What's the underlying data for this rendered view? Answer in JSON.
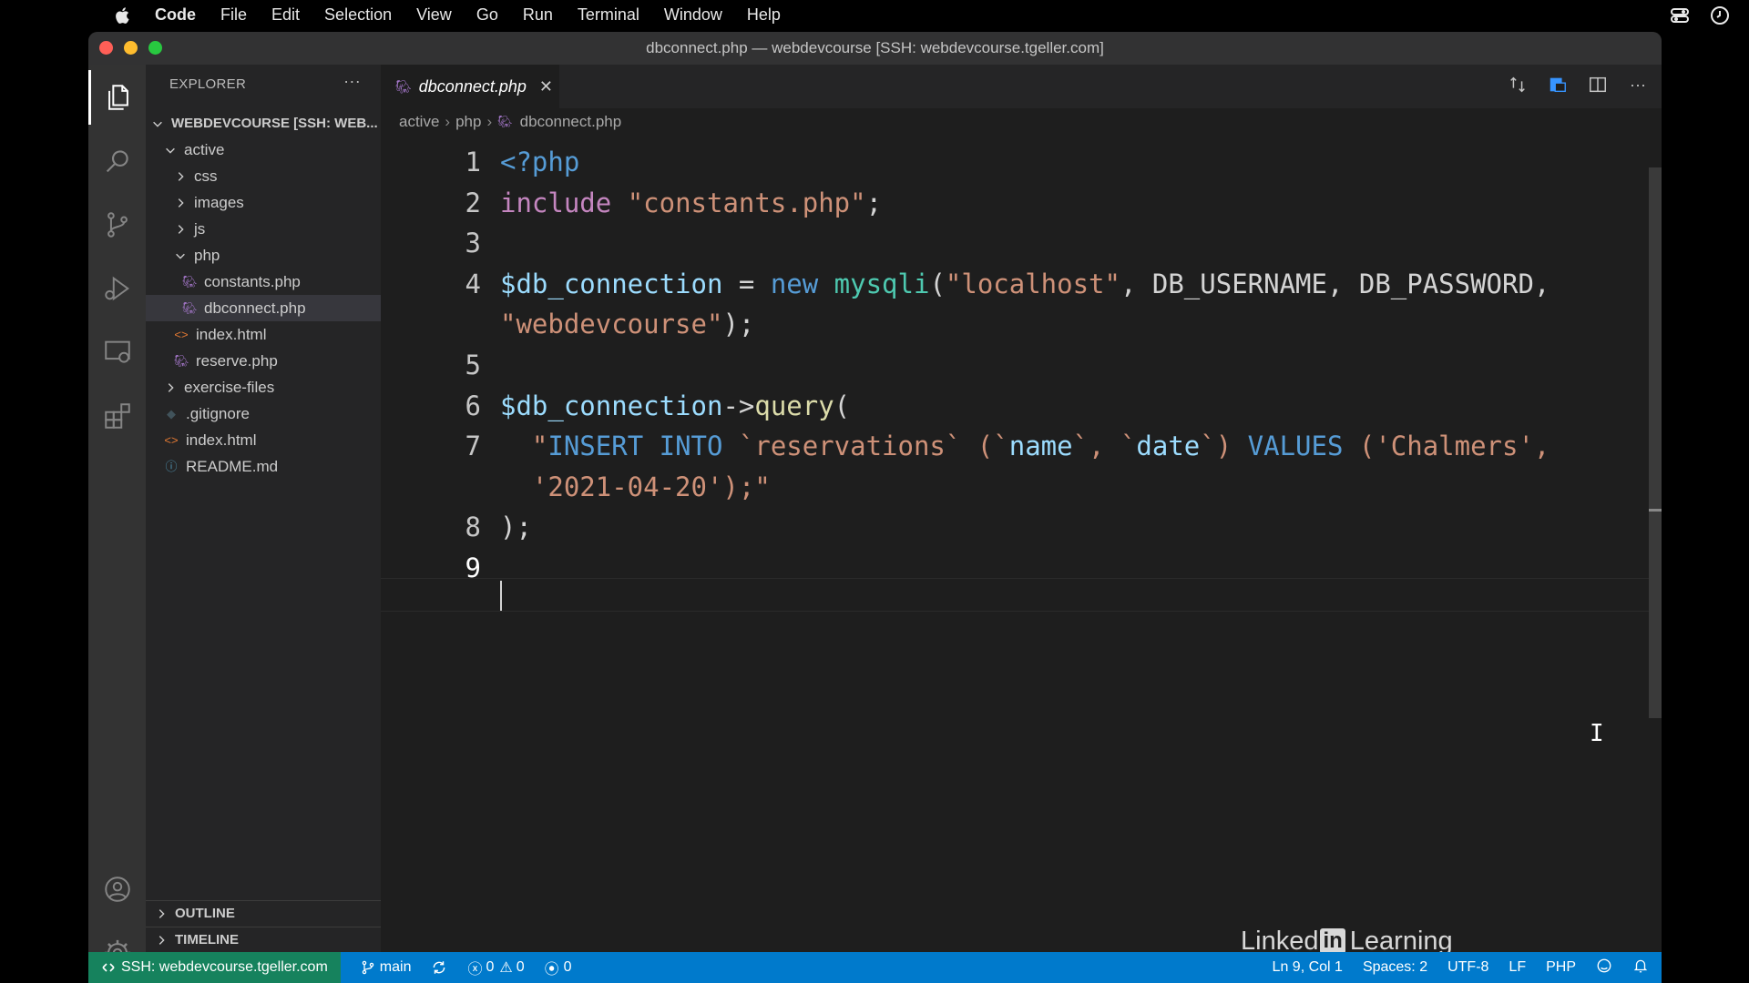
{
  "menubar": {
    "app": "Code",
    "items": [
      "File",
      "Edit",
      "Selection",
      "View",
      "Go",
      "Run",
      "Terminal",
      "Window",
      "Help"
    ]
  },
  "window": {
    "title": "dbconnect.php — webdevcourse [SSH: webdevcourse.tgeller.com]"
  },
  "sidebar": {
    "header": "EXPLORER",
    "root": "WEBDEVCOURSE [SSH: WEB...",
    "tree": [
      {
        "label": "active",
        "type": "folder-open",
        "depth": 1
      },
      {
        "label": "css",
        "type": "folder",
        "depth": 2
      },
      {
        "label": "images",
        "type": "folder",
        "depth": 2
      },
      {
        "label": "js",
        "type": "folder",
        "depth": 2
      },
      {
        "label": "php",
        "type": "folder-open",
        "depth": 2
      },
      {
        "label": "constants.php",
        "type": "php",
        "depth": 3
      },
      {
        "label": "dbconnect.php",
        "type": "php",
        "depth": 3,
        "selected": true
      },
      {
        "label": "index.html",
        "type": "html",
        "depth": 2
      },
      {
        "label": "reserve.php",
        "type": "php",
        "depth": 2
      },
      {
        "label": "exercise-files",
        "type": "folder",
        "depth": 1
      },
      {
        "label": ".gitignore",
        "type": "git",
        "depth": 1
      },
      {
        "label": "index.html",
        "type": "html",
        "depth": 1
      },
      {
        "label": "README.md",
        "type": "info",
        "depth": 1
      }
    ],
    "outline": "OUTLINE",
    "timeline": "TIMELINE"
  },
  "editor": {
    "tab": "dbconnect.php",
    "breadcrumb": [
      "active",
      "php",
      "dbconnect.php"
    ],
    "line_numbers": [
      "1",
      "2",
      "3",
      "4",
      "5",
      "6",
      "7",
      "8",
      "9"
    ],
    "lines": [
      [
        {
          "t": "<?php",
          "c": "kw"
        }
      ],
      [
        {
          "t": "include ",
          "c": "inc"
        },
        {
          "t": "\"constants.php\"",
          "c": "str"
        },
        {
          "t": ";",
          "c": ""
        }
      ],
      [],
      [
        {
          "t": "$db_connection",
          "c": "var"
        },
        {
          "t": " = ",
          "c": ""
        },
        {
          "t": "new ",
          "c": "kw"
        },
        {
          "t": "mysqli",
          "c": "cls"
        },
        {
          "t": "(",
          "c": ""
        },
        {
          "t": "\"localhost\"",
          "c": "str"
        },
        {
          "t": ", ",
          "c": ""
        },
        {
          "t": "DB_USERNAME",
          "c": ""
        },
        {
          "t": ", ",
          "c": ""
        },
        {
          "t": "DB_PASSWORD",
          "c": ""
        },
        {
          "t": ",",
          "c": ""
        }
      ],
      [
        {
          "t": "\"webdevcourse\"",
          "c": "str"
        },
        {
          "t": ");",
          "c": ""
        }
      ],
      [],
      [
        {
          "t": "$db_connection",
          "c": "var"
        },
        {
          "t": "->",
          "c": ""
        },
        {
          "t": "query",
          "c": "fn"
        },
        {
          "t": "(",
          "c": ""
        }
      ],
      [
        {
          "t": "  \"",
          "c": "str"
        },
        {
          "t": "INSERT INTO",
          "c": "kw"
        },
        {
          "t": " `reservations` (`",
          "c": "str"
        },
        {
          "t": "name",
          "c": "var"
        },
        {
          "t": "`, `",
          "c": "str"
        },
        {
          "t": "date",
          "c": "var"
        },
        {
          "t": "`) ",
          "c": "str"
        },
        {
          "t": "VALUES",
          "c": "kw"
        },
        {
          "t": " ('Chalmers',",
          "c": "str"
        }
      ],
      [
        {
          "t": "  '2021-04-20');\"",
          "c": "str"
        }
      ],
      [
        {
          "t": ");",
          "c": ""
        }
      ],
      []
    ]
  },
  "watermark": {
    "left": "Linked",
    "in": "in",
    "right": "Learning"
  },
  "statusbar": {
    "remote": "SSH: webdevcourse.tgeller.com",
    "branch": "main",
    "errors": "0",
    "warnings": "0",
    "ports": "0",
    "position": "Ln 9, Col 1",
    "spaces": "Spaces: 2",
    "encoding": "UTF-8",
    "eol": "LF",
    "language": "PHP"
  }
}
